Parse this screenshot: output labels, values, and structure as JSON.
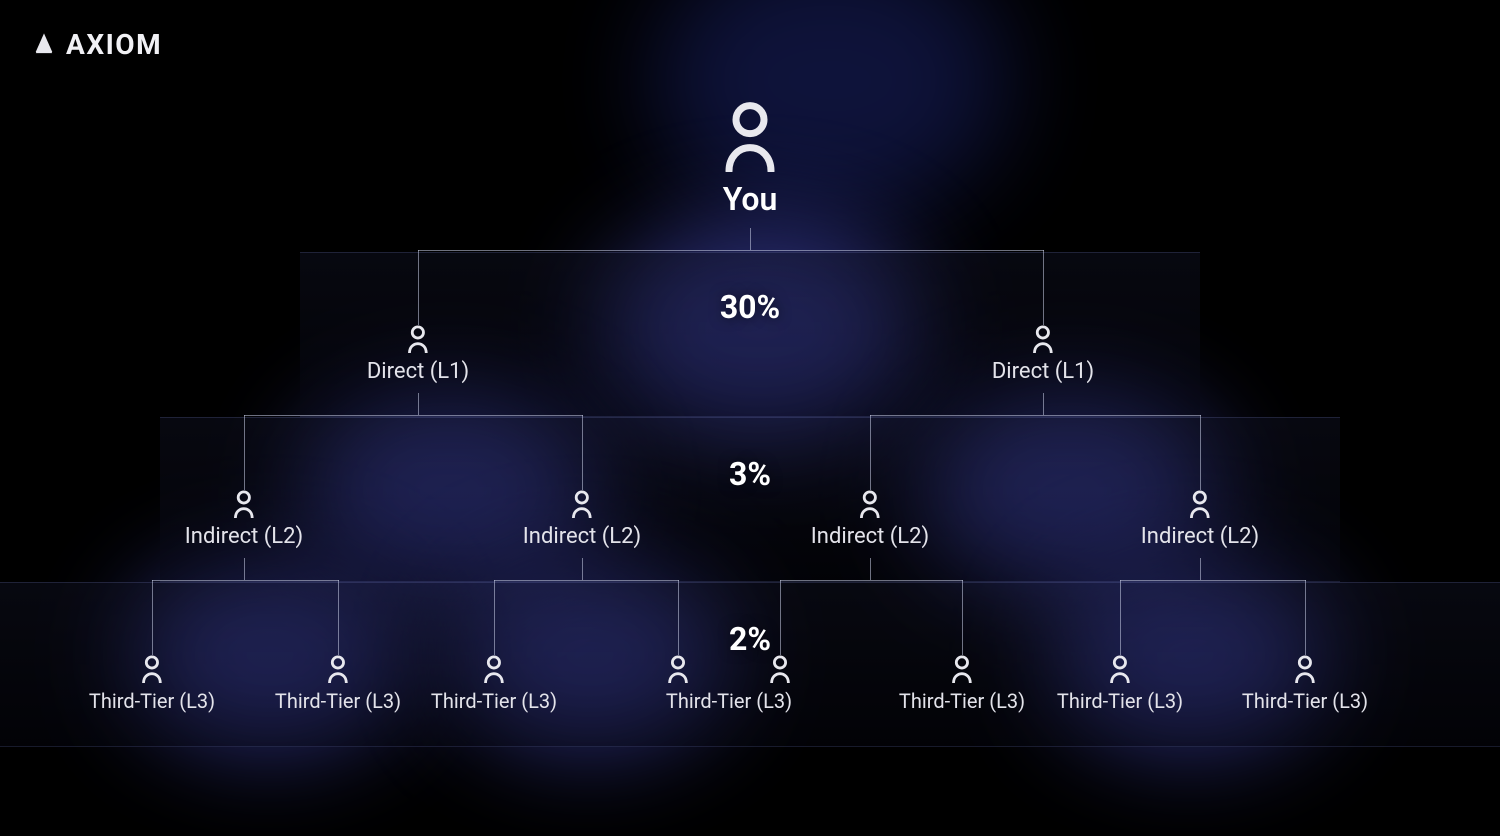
{
  "brand": {
    "name": "AXIOM"
  },
  "root": {
    "label": "You"
  },
  "tiers": {
    "l1": {
      "pct": "30%",
      "label": "Direct (L1)"
    },
    "l2": {
      "pct": "3%",
      "label": "Indirect (L2)"
    },
    "l3": {
      "pct": "2%",
      "label": "Third-Tier (L3)"
    }
  },
  "colors": {
    "glow": "#3a3fa0",
    "line": "#c8cde6"
  }
}
